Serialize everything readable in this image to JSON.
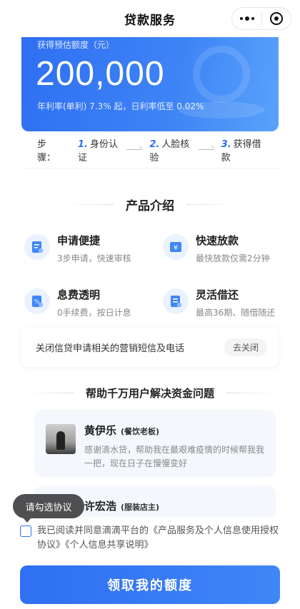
{
  "nav": {
    "title": "贷款服务"
  },
  "quota": {
    "label": "获得预估额度（元）",
    "amount": "200,000",
    "rate_note": "年利率(单利) 7.3% 起，日利率低至 0.02%"
  },
  "steps": {
    "label": "步骤：",
    "items": [
      {
        "num": "1.",
        "text": "身份认证"
      },
      {
        "num": "2.",
        "text": "人脸核验"
      },
      {
        "num": "3.",
        "text": "获得借款"
      }
    ]
  },
  "intro": {
    "title": "产品介绍",
    "features": [
      {
        "title": "申请便捷",
        "desc": "3步申请，快速审核",
        "icon": "document-icon"
      },
      {
        "title": "快速放款",
        "desc": "最快放款仅需2分钟",
        "icon": "yen-icon"
      },
      {
        "title": "息费透明",
        "desc": "0手续费，按日计息",
        "icon": "percent-icon"
      },
      {
        "title": "灵活借还",
        "desc": "最高36期、随借随还",
        "icon": "repay-icon"
      }
    ]
  },
  "marketing": {
    "text": "关闭信贷申请相关的营销短信及电话",
    "button": "去关闭"
  },
  "help": {
    "title": "帮助千万用户解决资金问题",
    "testimonials": [
      {
        "name": "黄伊乐",
        "role": "(餐饮老板)",
        "text": "感谢滴水贷，帮助我在最艰难疫情的时候帮我我一把，现在日子在慢慢变好"
      },
      {
        "name": "许宏浩",
        "role": "(服装店主)",
        "text": ""
      }
    ]
  },
  "tooltip": "请勾选协议",
  "agreement": {
    "prefix": "我已阅读并同意滴滴平台的",
    "link1": "《产品服务及个人信息使用授权协议》",
    "link2": "《个人信息共享说明》"
  },
  "cta": "领取我的额度",
  "colors": {
    "primary": "#2f6ff2",
    "tooltip_bg": "#4f4f52"
  }
}
